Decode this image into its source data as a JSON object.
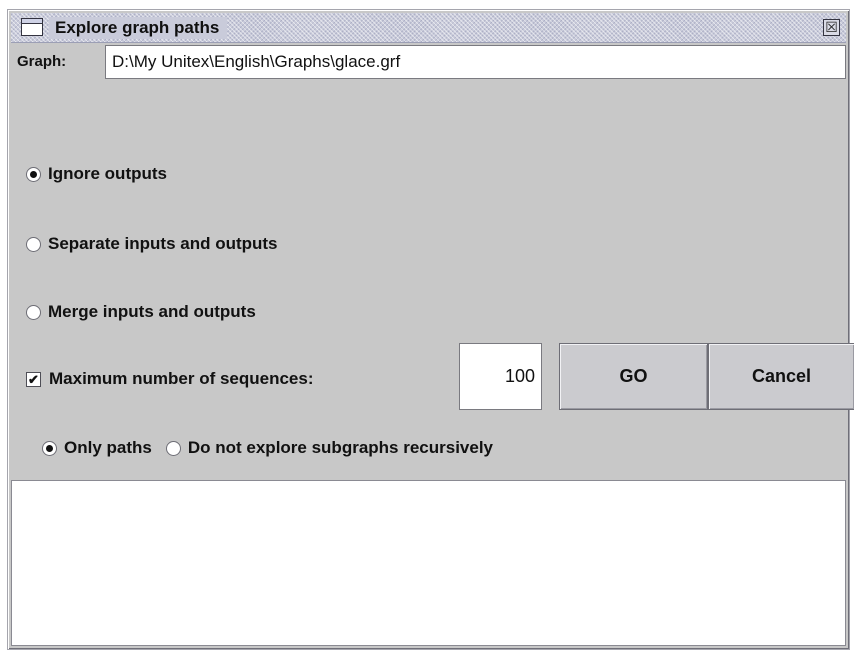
{
  "window": {
    "title": "Explore graph paths",
    "close_glyph": "☒"
  },
  "graph": {
    "label": "Graph:",
    "path": "D:\\My Unitex\\English\\Graphs\\glace.grf"
  },
  "output_mode": {
    "options": [
      {
        "label": "Ignore outputs",
        "selected": true
      },
      {
        "label": "Separate inputs and outputs",
        "selected": false
      },
      {
        "label": "Merge inputs and outputs",
        "selected": false
      }
    ]
  },
  "max_sequences": {
    "label": "Maximum number of sequences:",
    "checked": true,
    "check_glyph": "✔",
    "value": "100"
  },
  "buttons": {
    "go": "GO",
    "cancel": "Cancel"
  },
  "path_mode": {
    "options": [
      {
        "label": "Only paths",
        "selected": true
      },
      {
        "label": "Do not explore subgraphs recursively",
        "selected": false
      }
    ]
  },
  "colors": {
    "window_bg": "#c8c8c8",
    "titlebar_bg": "#c9cbda",
    "field_bg": "#ffffff"
  },
  "icons": {
    "title": "window-icon",
    "close": "close-icon"
  }
}
